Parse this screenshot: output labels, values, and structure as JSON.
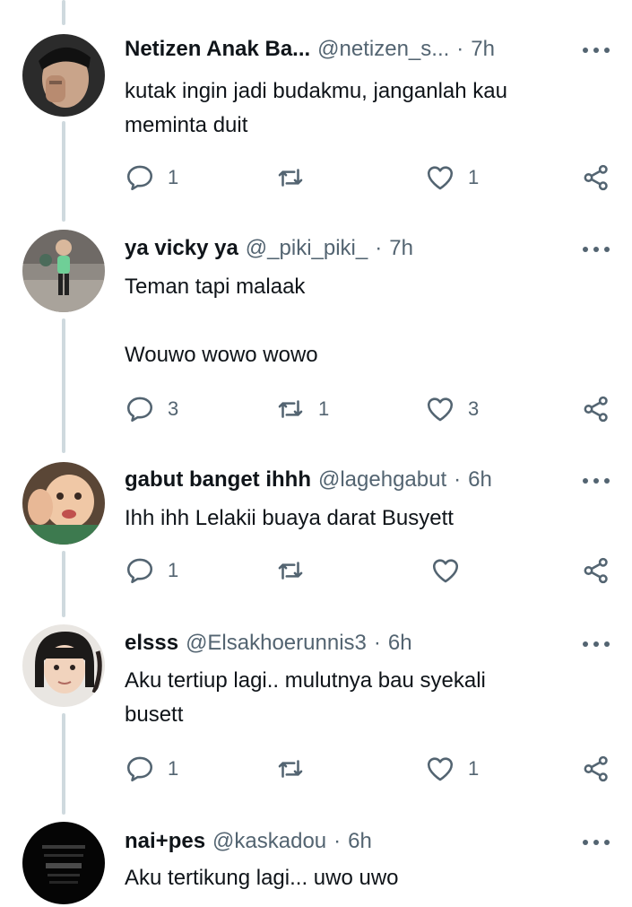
{
  "replies": [
    {
      "name": "Netizen Anak Ba...",
      "handle": "@netizen_s...",
      "time": "7h",
      "text": "kutak ingin jadi budakmu, janganlah kau\nmeminta duit",
      "reply_count": "1",
      "retweet_count": "",
      "like_count": "1"
    },
    {
      "name": "ya vicky ya",
      "handle": "@_piki_piki_",
      "time": "7h",
      "text": "Teman tapi malaak\n\nWouwo wowo wowo",
      "reply_count": "3",
      "retweet_count": "1",
      "like_count": "3"
    },
    {
      "name": "gabut banget ihhh",
      "handle": "@lagehgabut",
      "time": "6h",
      "text": "Ihh ihh Lelakii buaya darat Busyett",
      "reply_count": "1",
      "retweet_count": "",
      "like_count": ""
    },
    {
      "name": "elsss",
      "handle": "@Elsakhoerunnis3",
      "time": "6h",
      "text": "Aku tertiup lagi.. mulutnya bau syekali\nbusett",
      "reply_count": "1",
      "retweet_count": "",
      "like_count": "1"
    },
    {
      "name": "nai+pes",
      "handle": "@kaskadou",
      "time": "6h",
      "text": "Aku tertikung lagi... uwo uwo",
      "reply_count": "",
      "retweet_count": "",
      "like_count": ""
    }
  ],
  "colors": {
    "text_primary": "#0f1419",
    "text_secondary": "#536471",
    "thread_line": "#cfd9de"
  },
  "icons": [
    "reply-icon",
    "retweet-icon",
    "like-icon",
    "share-icon",
    "more-icon"
  ]
}
